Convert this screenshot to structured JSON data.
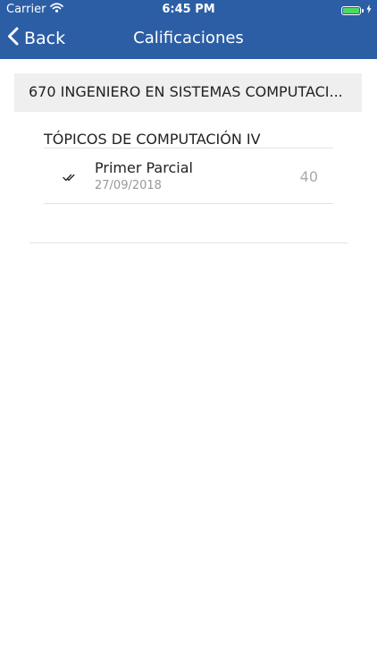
{
  "status_bar": {
    "carrier": "Carrier",
    "time": "6:45 PM",
    "wifi_icon": "wifi-icon",
    "battery_icon": "battery-icon",
    "charging_icon": "charging-bolt-icon",
    "battery_level": 1.0,
    "battery_color": "#4cd964"
  },
  "nav": {
    "back_label": "Back",
    "back_icon": "chevron-left-icon",
    "title": "Calificaciones",
    "background_color": "#2c5ea6"
  },
  "career": {
    "name": "670 INGENIERO EN SISTEMAS COMPUTACI..."
  },
  "subjects": [
    {
      "name": "TÓPICOS DE COMPUTACIÓN IV",
      "evaluations": [
        {
          "status_icon": "double-check-icon",
          "name": "Primer Parcial",
          "date": "27/09/2018",
          "score": "40"
        }
      ]
    }
  ]
}
